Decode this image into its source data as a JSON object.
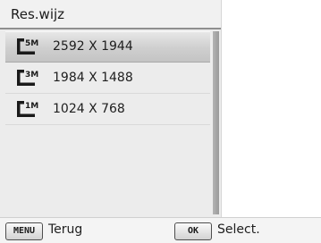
{
  "menu": {
    "title": "Res.wijz",
    "items": [
      {
        "icon": "5m-resolution-icon",
        "icon_text": "5M",
        "label": "2592 X 1944",
        "selected": true
      },
      {
        "icon": "3m-resolution-icon",
        "icon_text": "3M",
        "label": "1984 X 1488",
        "selected": false
      },
      {
        "icon": "1m-resolution-icon",
        "icon_text": "1M",
        "label": "1024 X 768",
        "selected": false
      }
    ]
  },
  "bottom_bar": {
    "menu_key": "MENU",
    "back_label": "Terug",
    "ok_key": "OK",
    "select_label": "Select."
  },
  "colors": {
    "panel_bg": "#ececec",
    "selected_bg": "#cfcfcf",
    "text": "#1e1e1e"
  }
}
